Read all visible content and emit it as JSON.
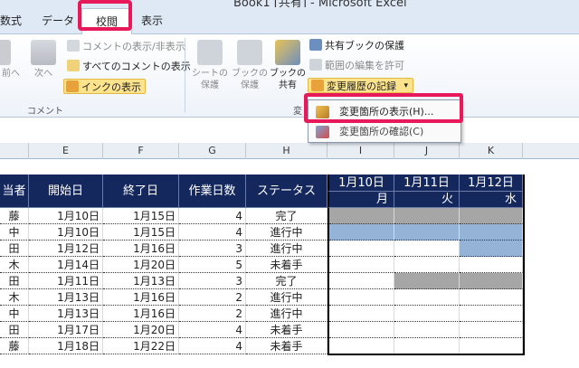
{
  "window": {
    "title": "Book1 [共有] - Microsoft Excel"
  },
  "tabs": [
    {
      "label": "数式"
    },
    {
      "label": "データ"
    },
    {
      "label": "校閲"
    },
    {
      "label": "表示"
    }
  ],
  "ribbon": {
    "comments": {
      "prev_label": "前へ",
      "next_label": "次へ",
      "show_hide": "コメントの表示/非表示",
      "show_all": "すべてのコメントの表示",
      "show_ink": "インクの表示",
      "group_label": "コメント"
    },
    "changes": {
      "protect_sheet": [
        "シートの",
        "保護"
      ],
      "protect_book": [
        "ブックの",
        "保護"
      ],
      "share_book": [
        "ブックの",
        "共有"
      ],
      "protect_shared": "共有ブックの保護",
      "allow_edit_ranges": "範囲の編集を許可",
      "track_changes": "変更履歴の記録",
      "group_label": "変"
    }
  },
  "dropdown": {
    "highlight_changes": "変更箇所の表示(H)...",
    "accept_reject": "変更箇所の確認(C)"
  },
  "columns": [
    "E",
    "F",
    "G",
    "H",
    "I",
    "J",
    "K"
  ],
  "table": {
    "headers": [
      "当者",
      "開始日",
      "終了日",
      "作業日数",
      "ステータス"
    ],
    "date_headers": [
      {
        "date": "1月10日",
        "day": "月"
      },
      {
        "date": "1月11日",
        "day": "火"
      },
      {
        "date": "1月12日",
        "day": "水"
      }
    ],
    "rows": [
      {
        "who": "藤",
        "start": "1月10日",
        "end": "1月15日",
        "days": "4",
        "status": "完了",
        "gantt": [
          "gray",
          "gray",
          "gray"
        ]
      },
      {
        "who": "中",
        "start": "1月10日",
        "end": "1月15日",
        "days": "4",
        "status": "進行中",
        "gantt": [
          "blue",
          "blue",
          "blue"
        ]
      },
      {
        "who": "田",
        "start": "1月12日",
        "end": "1月16日",
        "days": "3",
        "status": "進行中",
        "gantt": [
          "",
          "",
          "blue"
        ]
      },
      {
        "who": "木",
        "start": "1月14日",
        "end": "1月20日",
        "days": "5",
        "status": "未着手",
        "gantt": [
          "",
          "",
          ""
        ]
      },
      {
        "who": "田",
        "start": "1月11日",
        "end": "1月13日",
        "days": "3",
        "status": "完了",
        "gantt": [
          "",
          "gray",
          "gray"
        ]
      },
      {
        "who": "木",
        "start": "1月13日",
        "end": "1月16日",
        "days": "2",
        "status": "進行中",
        "gantt": [
          "",
          "",
          ""
        ]
      },
      {
        "who": "中",
        "start": "1月13日",
        "end": "1月16日",
        "days": "2",
        "status": "進行中",
        "gantt": [
          "",
          "",
          ""
        ]
      },
      {
        "who": "田",
        "start": "1月17日",
        "end": "1月20日",
        "days": "4",
        "status": "未着手",
        "gantt": [
          "",
          "",
          ""
        ]
      },
      {
        "who": "藤",
        "start": "1月18日",
        "end": "1月22日",
        "days": "4",
        "status": "未着手",
        "gantt": [
          "",
          "",
          ""
        ]
      }
    ]
  }
}
